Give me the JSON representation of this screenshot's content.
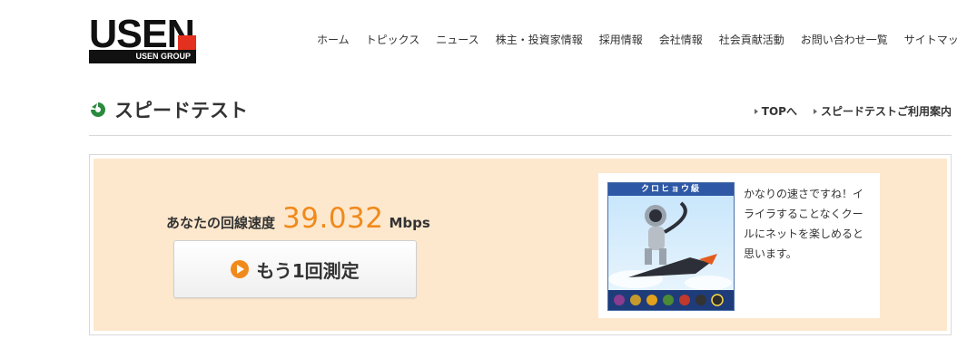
{
  "header": {
    "logo_word": "USEN",
    "logo_group": "USEN GROUP",
    "nav": [
      "ホーム",
      "トピックス",
      "ニュース",
      "株主・投資家情報",
      "採用情報",
      "会社情報",
      "社会貢献活動",
      "お問い合わせ一覧",
      "サイトマップ"
    ]
  },
  "page": {
    "title": "スピードテスト",
    "links": [
      "TOPへ",
      "スピードテストご利用案内"
    ]
  },
  "result": {
    "label": "あなたの回線速度",
    "speed": "39.032",
    "unit": "Mbps",
    "retest_label": "もう1回測定",
    "rank_title": "クロヒョウ級",
    "comment": "かなりの速さですね！イライラすることなくクールにネットを楽しめると思います。"
  },
  "colors": {
    "accent": "#f08a1c",
    "panel_bg": "#fde8cd",
    "logo_red": "#e4301e",
    "badge_header": "#2e58a5"
  }
}
